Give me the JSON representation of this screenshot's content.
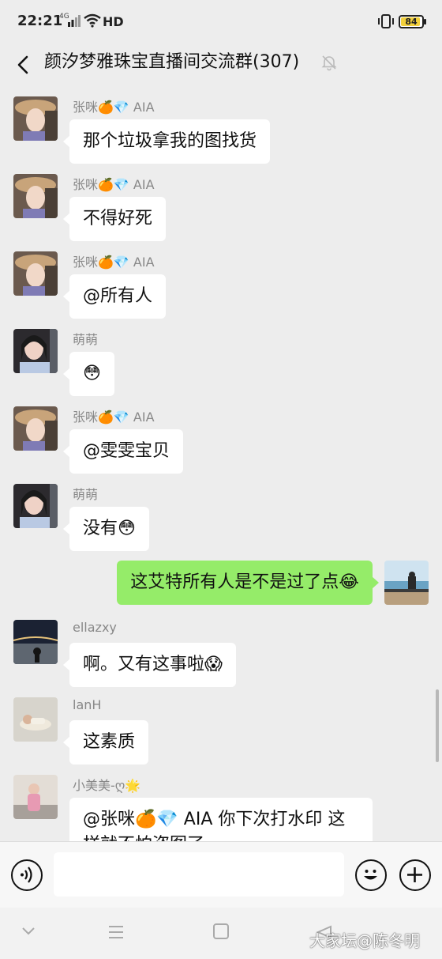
{
  "status_bar": {
    "time": "22:21",
    "network": "4G",
    "hd": "HD",
    "battery": "84",
    "battery_color": "#f2d03b"
  },
  "header": {
    "title": "颜汐梦雅珠宝直播间交流群(307)",
    "back_icon": "back-arrow-icon",
    "mute_icon": "muted-bell-icon"
  },
  "messages": [
    {
      "side": "left",
      "nickname": "张咪🍊💎 AIA",
      "text": "那个垃圾拿我的图找货",
      "avatar": "avatar-zhangmi"
    },
    {
      "side": "left",
      "nickname": "张咪🍊💎 AIA",
      "text": "不得好死",
      "avatar": "avatar-zhangmi"
    },
    {
      "side": "left",
      "nickname": "张咪🍊💎 AIA",
      "text": "@所有人",
      "avatar": "avatar-zhangmi"
    },
    {
      "side": "left",
      "nickname": "萌萌",
      "text": "😳",
      "avatar": "avatar-mengmeng"
    },
    {
      "side": "left",
      "nickname": "张咪🍊💎 AIA",
      "text": "@雯雯宝贝",
      "avatar": "avatar-zhangmi"
    },
    {
      "side": "left",
      "nickname": "萌萌",
      "text": "没有😳",
      "avatar": "avatar-mengmeng"
    },
    {
      "side": "right",
      "nickname": "",
      "text": "这艾特所有人是不是过了点😂",
      "avatar": "avatar-self"
    },
    {
      "side": "left",
      "nickname": "ellazxy",
      "text": "啊。又有这事啦😱",
      "avatar": "avatar-ellazxy"
    },
    {
      "side": "left",
      "nickname": "lanH",
      "text": "这素质",
      "avatar": "avatar-lanh"
    },
    {
      "side": "left",
      "nickname": "小美美-ღ🌟",
      "text": "@张咪🍊💎 AIA  你下次打水印 这样就不怕盗图了",
      "avatar": "avatar-xiaomeimei"
    }
  ],
  "input_bar": {
    "voice_icon": "voice-icon",
    "emoji_icon": "emoji-icon",
    "plus_icon": "plus-icon",
    "input_value": ""
  },
  "nav_bar": {
    "watermark": "大家坛@陈冬明"
  },
  "colors": {
    "background": "#ededed",
    "self_bubble": "#95ec69",
    "other_bubble": "#ffffff"
  }
}
